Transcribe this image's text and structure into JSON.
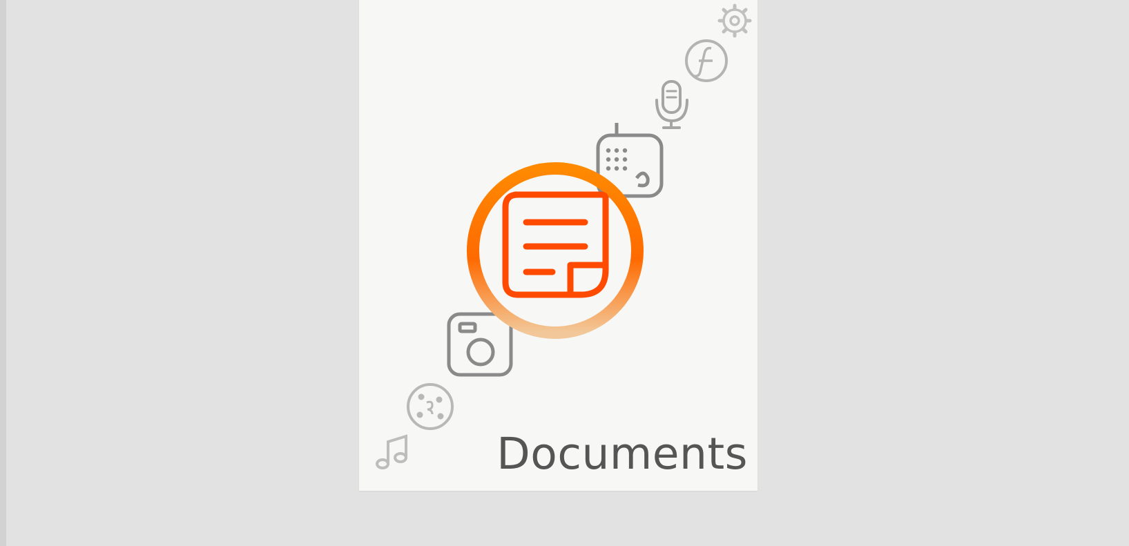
{
  "tile": {
    "label": "Documents",
    "accent_color": "#ff4a00",
    "ring_color": "#ff7a00"
  },
  "icons": [
    {
      "name": "music-note-icon",
      "selected": false
    },
    {
      "name": "cookie-icon",
      "selected": false
    },
    {
      "name": "camera-icon",
      "selected": false
    },
    {
      "name": "document-icon",
      "selected": true
    },
    {
      "name": "phone-dialpad-icon",
      "selected": false
    },
    {
      "name": "microphone-icon",
      "selected": false
    },
    {
      "name": "flash-icon",
      "selected": false
    },
    {
      "name": "gear-icon",
      "selected": false
    }
  ]
}
